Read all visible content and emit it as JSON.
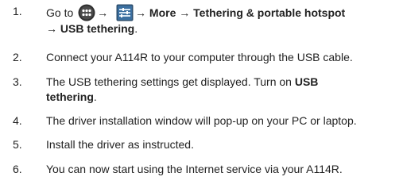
{
  "steps": [
    {
      "number": "1.",
      "goto": "Go to",
      "icon1": "apps-grid-icon",
      "arrow": "→",
      "icon2": "settings-icon",
      "path_bold_1": "→ More → Tethering & portable hotspot",
      "path_bold_2": "→ USB tethering",
      "end": "."
    },
    {
      "number": "2.",
      "text": "Connect your A114R to your computer through the USB cable."
    },
    {
      "number": "3.",
      "text_pre": "The USB tethering settings get displayed. Turn on",
      "bold_1": "USB",
      "bold_2": "tethering",
      "end": "."
    },
    {
      "number": "4.",
      "text": "The driver installation window will pop-up on your PC or laptop."
    },
    {
      "number": "5.",
      "text": "Install the driver as instructed."
    },
    {
      "number": "6.",
      "text": "You can now start using the Internet service via your A114R."
    }
  ],
  "colors": {
    "text": "#222222",
    "icon_dark": "#3a3a3a",
    "icon_blue": "#3b6fa0"
  }
}
